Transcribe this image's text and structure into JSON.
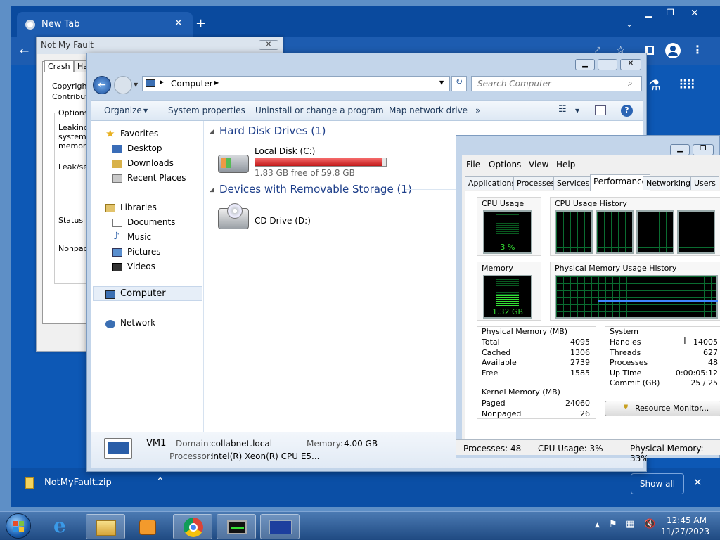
{
  "chrome": {
    "tab_title": "New Tab",
    "download": {
      "filename": "NotMyFault.zip",
      "show_all": "Show all"
    }
  },
  "notmyfault": {
    "title": "Not My Fault",
    "tabs": [
      "Crash",
      "Ha"
    ],
    "lines": [
      "Copyright",
      "Contributio"
    ],
    "options_label": "Options",
    "options_lines": [
      "Leaking",
      "system",
      "memory"
    ],
    "leak_label": "Leak/sec",
    "status_label": "Status",
    "status_text": "Nonpage"
  },
  "explorer": {
    "address": "Computer",
    "search_placeholder": "Search Computer",
    "commands": [
      "Organize",
      "System properties",
      "Uninstall or change a program",
      "Map network drive",
      "»"
    ],
    "nav": {
      "favorites": "Favorites",
      "favorites_items": [
        "Desktop",
        "Downloads",
        "Recent Places"
      ],
      "libraries": "Libraries",
      "libraries_items": [
        "Documents",
        "Music",
        "Pictures",
        "Videos"
      ],
      "computer": "Computer",
      "network": "Network"
    },
    "groups": {
      "hdd": "Hard Disk Drives (1)",
      "removable": "Devices with Removable Storage (1)"
    },
    "drives": {
      "c_name": "Local Disk (C:)",
      "c_free": "1.83 GB free of 59.8 GB",
      "c_used_fraction": 0.969,
      "d_name": "CD Drive (D:)"
    },
    "details": {
      "name": "VM1",
      "domain_label": "Domain:",
      "domain": "collabnet.local",
      "memory_label": "Memory:",
      "memory": "4.00 GB",
      "processor_label": "Processor:",
      "processor": "Intel(R) Xeon(R) CPU E5..."
    }
  },
  "taskmgr": {
    "menu": [
      "File",
      "Options",
      "View",
      "Help"
    ],
    "tabs": [
      "Applications",
      "Processes",
      "Services",
      "Performance",
      "Networking",
      "Users"
    ],
    "active_tab": "Performance",
    "cpu_usage_label": "CPU Usage",
    "cpu_usage_value": "3 %",
    "cpu_history_label": "CPU Usage History",
    "memory_label": "Memory",
    "memory_value": "1.32 GB",
    "phys_history_label": "Physical Memory Usage History",
    "physical": {
      "title": "Physical Memory (MB)",
      "rows": [
        {
          "k": "Total",
          "v": "4095"
        },
        {
          "k": "Cached",
          "v": "1306"
        },
        {
          "k": "Available",
          "v": "2739"
        },
        {
          "k": "Free",
          "v": "1585"
        }
      ]
    },
    "kernel": {
      "title": "Kernel Memory (MB)",
      "rows": [
        {
          "k": "Paged",
          "v": "24060"
        },
        {
          "k": "Nonpaged",
          "v": "26"
        }
      ]
    },
    "system": {
      "title": "System",
      "rows": [
        {
          "k": "Handles",
          "v": "14005"
        },
        {
          "k": "Threads",
          "v": "627"
        },
        {
          "k": "Processes",
          "v": "48"
        },
        {
          "k": "Up Time",
          "v": "0:00:05:12"
        },
        {
          "k": "Commit (GB)",
          "v": "25 / 25"
        }
      ]
    },
    "resource_monitor": "Resource Monitor...",
    "status": {
      "processes": "Processes: 48",
      "cpu": "CPU Usage: 3%",
      "memory": "Physical Memory: 33%"
    }
  },
  "taskbar": {
    "time": "12:45 AM",
    "date": "11/27/2023"
  }
}
